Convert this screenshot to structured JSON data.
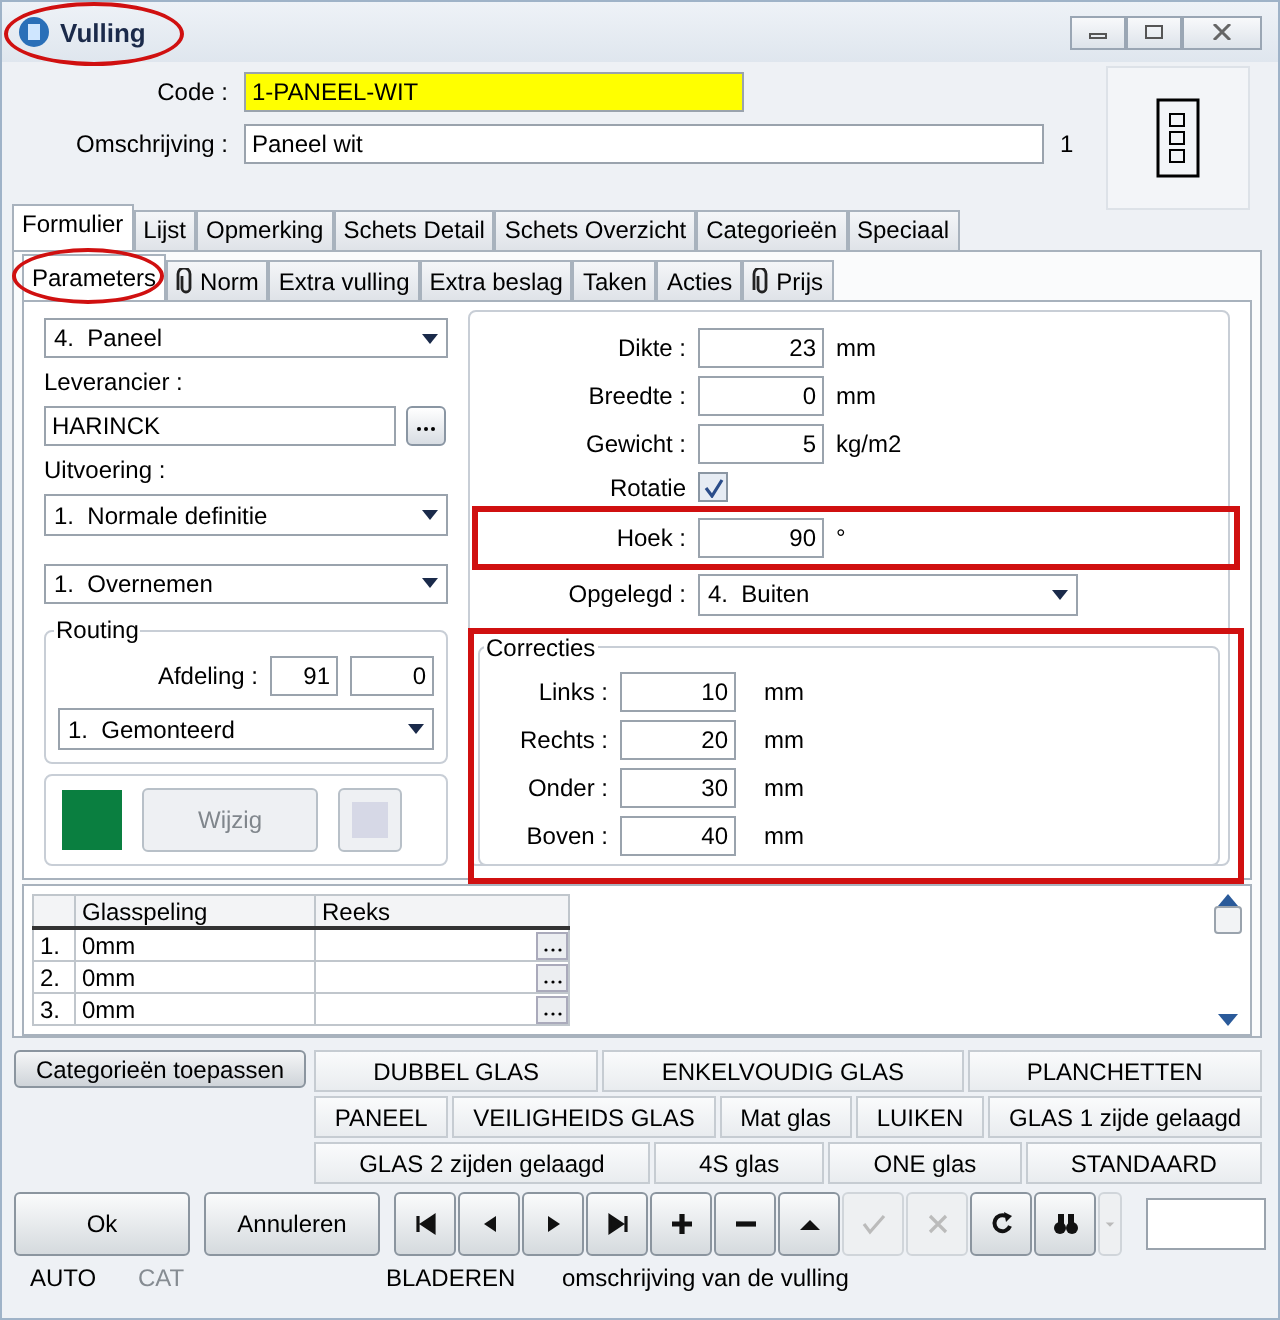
{
  "window": {
    "title": "Vulling",
    "highlighted": true
  },
  "header": {
    "code": {
      "label": "Code :",
      "value": "1-PANEEL-WIT"
    },
    "description": {
      "label": "Omschrijving :",
      "value": "Paneel wit",
      "count": "1"
    }
  },
  "main_tabs": [
    {
      "label": "Formulier",
      "selected": true
    },
    {
      "label": "Lijst",
      "selected": false
    },
    {
      "label": "Opmerking",
      "selected": false
    },
    {
      "label": "Schets Detail",
      "selected": false
    },
    {
      "label": "Schets Overzicht",
      "selected": false
    },
    {
      "label": "Categorieën",
      "selected": false
    },
    {
      "label": "Speciaal",
      "selected": false
    }
  ],
  "sub_tabs": [
    {
      "label": "Parameters",
      "selected": true,
      "attachment": false,
      "highlighted": true
    },
    {
      "label": "Norm",
      "selected": false,
      "attachment": true,
      "highlighted": false
    },
    {
      "label": "Extra vulling",
      "selected": false,
      "attachment": false,
      "highlighted": false
    },
    {
      "label": "Extra beslag",
      "selected": false,
      "attachment": false,
      "highlighted": false
    },
    {
      "label": "Taken",
      "selected": false,
      "attachment": false,
      "highlighted": false
    },
    {
      "label": "Acties",
      "selected": false,
      "attachment": false,
      "highlighted": false
    },
    {
      "label": "Prijs",
      "selected": false,
      "attachment": true,
      "highlighted": false
    }
  ],
  "left": {
    "type_select": "4.  Paneel",
    "supplier": {
      "label": "Leverancier :",
      "value": "HARINCK"
    },
    "execution": {
      "label": "Uitvoering :",
      "value": "1.  Normale definitie"
    },
    "takeover_select": "1.  Overnemen",
    "routing": {
      "title": "Routing",
      "department_label": "Afdeling :",
      "department": "91",
      "sub": "0",
      "select": "1.  Gemonteerd"
    },
    "colour": {
      "button": "Wijzig",
      "disabled": true
    }
  },
  "right": {
    "fields": [
      {
        "label": "Dikte :",
        "value": "23",
        "unit": "mm"
      },
      {
        "label": "Breedte :",
        "value": "0",
        "unit": "mm"
      },
      {
        "label": "Gewicht :",
        "value": "5",
        "unit": "kg/m2"
      }
    ],
    "rotation": {
      "label": "Rotatie",
      "checked": true
    },
    "angle": {
      "label": "Hoek :",
      "value": "90",
      "unit": "°",
      "highlighted": true
    },
    "laid": {
      "label": "Opgelegd :",
      "value": "4.  Buiten"
    },
    "corrections": {
      "title": "Correcties",
      "highlighted": true,
      "fields": [
        {
          "label": "Links :",
          "value": "10",
          "unit": "mm"
        },
        {
          "label": "Rechts :",
          "value": "20",
          "unit": "mm"
        },
        {
          "label": "Onder :",
          "value": "30",
          "unit": "mm"
        },
        {
          "label": "Boven :",
          "value": "40",
          "unit": "mm"
        }
      ]
    }
  },
  "grid": {
    "columns": [
      "Glasspeling",
      "Reeks"
    ],
    "rows": [
      {
        "index": "1.",
        "glasspeling": "0mm"
      },
      {
        "index": "2.",
        "glasspeling": "0mm"
      },
      {
        "index": "3.",
        "glasspeling": "0mm"
      }
    ]
  },
  "categories": {
    "apply_button": "Categorieën toepassen",
    "rows": [
      {
        "buttons": [
          "DUBBEL GLAS",
          "ENKELVOUDIG GLAS",
          "PLANCHETTEN"
        ]
      },
      {
        "buttons": [
          "PANEEL",
          "VEILIGHEIDS GLAS",
          "Mat glas",
          "LUIKEN",
          "GLAS 1 zijde gelaagd"
        ]
      },
      {
        "buttons": [
          "GLAS 2 zijden gelaagd",
          "4S glas",
          "ONE glas",
          "STANDAARD"
        ]
      }
    ]
  },
  "toolbar": {
    "ok": "Ok",
    "cancel": "Annuleren",
    "tools": [
      {
        "kind": "first",
        "disabled": false
      },
      {
        "kind": "previous",
        "disabled": false
      },
      {
        "kind": "next",
        "disabled": false
      },
      {
        "kind": "last",
        "disabled": false
      },
      {
        "kind": "add",
        "disabled": false
      },
      {
        "kind": "remove",
        "disabled": false
      },
      {
        "kind": "up",
        "disabled": false
      },
      {
        "kind": "confirm",
        "disabled": true
      },
      {
        "kind": "cancel",
        "disabled": true
      },
      {
        "kind": "refresh",
        "disabled": false
      },
      {
        "kind": "search",
        "disabled": false
      },
      {
        "kind": "dropdown",
        "disabled": true
      }
    ]
  },
  "status_bar": [
    {
      "text": "AUTO",
      "disabled": false
    },
    {
      "text": "CAT",
      "disabled": true
    },
    {
      "text": "BLADEREN",
      "disabled": false
    },
    {
      "text": "omschrijving van de vulling",
      "disabled": false
    }
  ]
}
